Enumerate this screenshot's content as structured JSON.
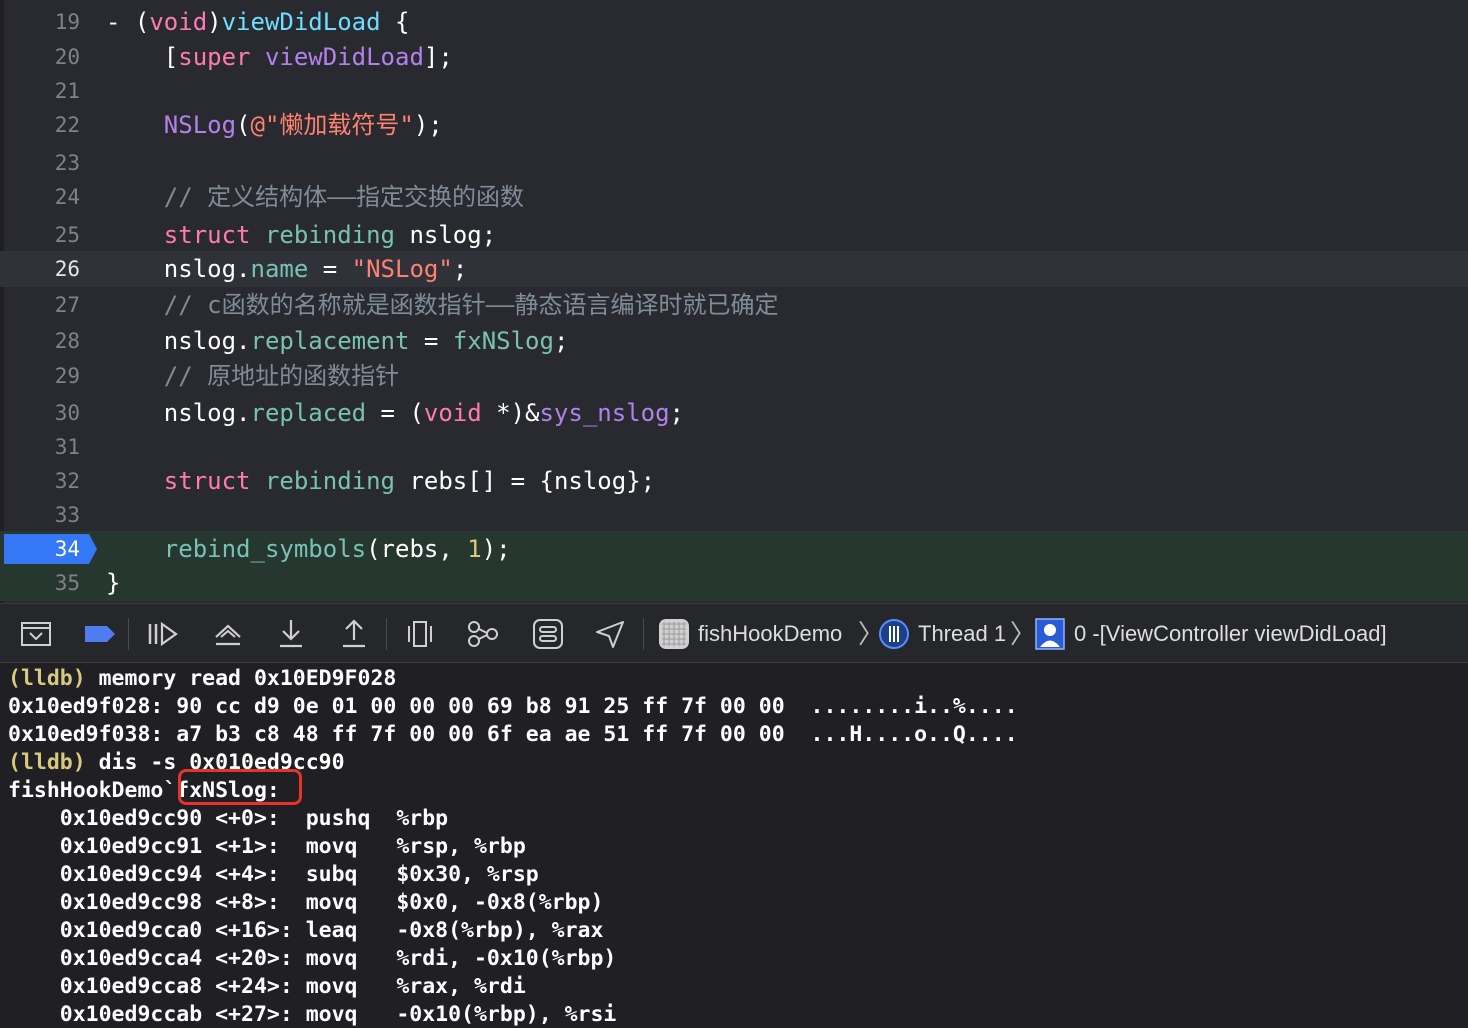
{
  "editor": {
    "lines": [
      {
        "num": "19",
        "tokens": [
          [
            "plain",
            "- ("
          ],
          [
            "kw",
            "void"
          ],
          [
            "plain",
            ")"
          ],
          [
            "meth",
            "viewDidLoad"
          ],
          [
            "plain",
            " {"
          ]
        ]
      },
      {
        "num": "20",
        "tokens": [
          [
            "plain",
            "    ["
          ],
          [
            "kw",
            "super"
          ],
          [
            "plain",
            " "
          ],
          [
            "fn",
            "viewDidLoad"
          ],
          [
            "plain",
            "];"
          ]
        ]
      },
      {
        "num": "21",
        "tokens": []
      },
      {
        "num": "22",
        "tokens": [
          [
            "plain",
            "    "
          ],
          [
            "fn",
            "NSLog"
          ],
          [
            "plain",
            "("
          ],
          [
            "str",
            "@\"懒加载符号\""
          ],
          [
            "plain",
            ");"
          ]
        ]
      },
      {
        "num": "23",
        "tokens": []
      },
      {
        "num": "24",
        "tokens": [
          [
            "plain",
            "    "
          ],
          [
            "cmt",
            "// 定义结构体——指定交换的函数"
          ]
        ]
      },
      {
        "num": "25",
        "tokens": [
          [
            "plain",
            "    "
          ],
          [
            "kw",
            "struct"
          ],
          [
            "plain",
            " "
          ],
          [
            "call",
            "rebinding"
          ],
          [
            "plain",
            " nslog;"
          ]
        ]
      },
      {
        "num": "26",
        "tokens": [
          [
            "plain",
            "    nslog."
          ],
          [
            "prop",
            "name"
          ],
          [
            "plain",
            " = "
          ],
          [
            "str",
            "\"NSLog\""
          ],
          [
            "plain",
            ";"
          ]
        ]
      },
      {
        "num": "27",
        "tokens": [
          [
            "plain",
            "    "
          ],
          [
            "cmt",
            "// c函数的名称就是函数指针——静态语言编译时就已确定"
          ]
        ]
      },
      {
        "num": "28",
        "tokens": [
          [
            "plain",
            "    nslog."
          ],
          [
            "prop",
            "replacement"
          ],
          [
            "plain",
            " = "
          ],
          [
            "call",
            "fxNSlog"
          ],
          [
            "plain",
            ";"
          ]
        ]
      },
      {
        "num": "29",
        "tokens": [
          [
            "plain",
            "    "
          ],
          [
            "cmt",
            "// 原地址的函数指针"
          ]
        ]
      },
      {
        "num": "30",
        "tokens": [
          [
            "plain",
            "    nslog."
          ],
          [
            "prop",
            "replaced"
          ],
          [
            "plain",
            " = ("
          ],
          [
            "kw",
            "void"
          ],
          [
            "plain",
            " *)&"
          ],
          [
            "fn",
            "sys_nslog"
          ],
          [
            "plain",
            ";"
          ]
        ]
      },
      {
        "num": "31",
        "tokens": []
      },
      {
        "num": "32",
        "tokens": [
          [
            "plain",
            "    "
          ],
          [
            "kw",
            "struct"
          ],
          [
            "plain",
            " "
          ],
          [
            "call",
            "rebinding"
          ],
          [
            "plain",
            " rebs[] = {nslog};"
          ]
        ]
      },
      {
        "num": "33",
        "tokens": []
      },
      {
        "num": "34",
        "tokens": [
          [
            "plain",
            "    "
          ],
          [
            "call",
            "rebind_symbols"
          ],
          [
            "plain",
            "(rebs, "
          ],
          [
            "num",
            "1"
          ],
          [
            "plain",
            ");"
          ]
        ]
      },
      {
        "num": "35",
        "tokens": [
          [
            "plain",
            "}"
          ]
        ]
      }
    ],
    "current_line": "26",
    "pc_line": "34"
  },
  "debugbar": {
    "icons": [
      "hide-debug-area-icon",
      "breakpoints-toggle-icon",
      "continue-icon",
      "step-over-icon",
      "step-into-icon",
      "step-out-icon",
      "view-hierarchy-icon",
      "memory-graph-icon",
      "environment-overrides-icon",
      "simulate-location-icon"
    ],
    "target": "fishHookDemo",
    "thread": "Thread 1",
    "frame": "0 -[ViewController viewDidLoad]"
  },
  "console": {
    "lines": [
      {
        "prompt": "(lldb)",
        "text": " memory read 0x10ED9F028"
      },
      {
        "prompt": "",
        "text": "0x10ed9f028: 90 cc d9 0e 01 00 00 00 69 b8 91 25 ff 7f 00 00  ........i..%...."
      },
      {
        "prompt": "",
        "text": "0x10ed9f038: a7 b3 c8 48 ff 7f 00 00 6f ea ae 51 ff 7f 00 00  ...H....o..Q...."
      },
      {
        "prompt": "(lldb)",
        "text": " dis -s 0x010ed9cc90"
      },
      {
        "prompt": "",
        "text": "fishHookDemo`fxNSlog:"
      },
      {
        "prompt": "",
        "text": "    0x10ed9cc90 <+0>:  pushq  %rbp"
      },
      {
        "prompt": "",
        "text": "    0x10ed9cc91 <+1>:  movq   %rsp, %rbp"
      },
      {
        "prompt": "",
        "text": "    0x10ed9cc94 <+4>:  subq   $0x30, %rsp"
      },
      {
        "prompt": "",
        "text": "    0x10ed9cc98 <+8>:  movq   $0x0, -0x8(%rbp)"
      },
      {
        "prompt": "",
        "text": "    0x10ed9cca0 <+16>: leaq   -0x8(%rbp), %rax"
      },
      {
        "prompt": "",
        "text": "    0x10ed9cca4 <+20>: movq   %rdi, -0x10(%rbp)"
      },
      {
        "prompt": "",
        "text": "    0x10ed9cca8 <+24>: movq   %rax, %rdi"
      },
      {
        "prompt": "",
        "text": "    0x10ed9ccab <+27>: movq   -0x10(%rbp), %rsi"
      }
    ],
    "highlighted_symbol": "fxNSlog:"
  },
  "colors": {
    "editor_bg": "#292a30",
    "console_bg": "#1f1f24",
    "keyword": "#ff7ab2",
    "string": "#ff8170",
    "comment": "#7f8c98",
    "pc_arrow": "#3478f6",
    "highlight_box": "#e8322a",
    "lldb_prompt": "#d9c97c"
  }
}
